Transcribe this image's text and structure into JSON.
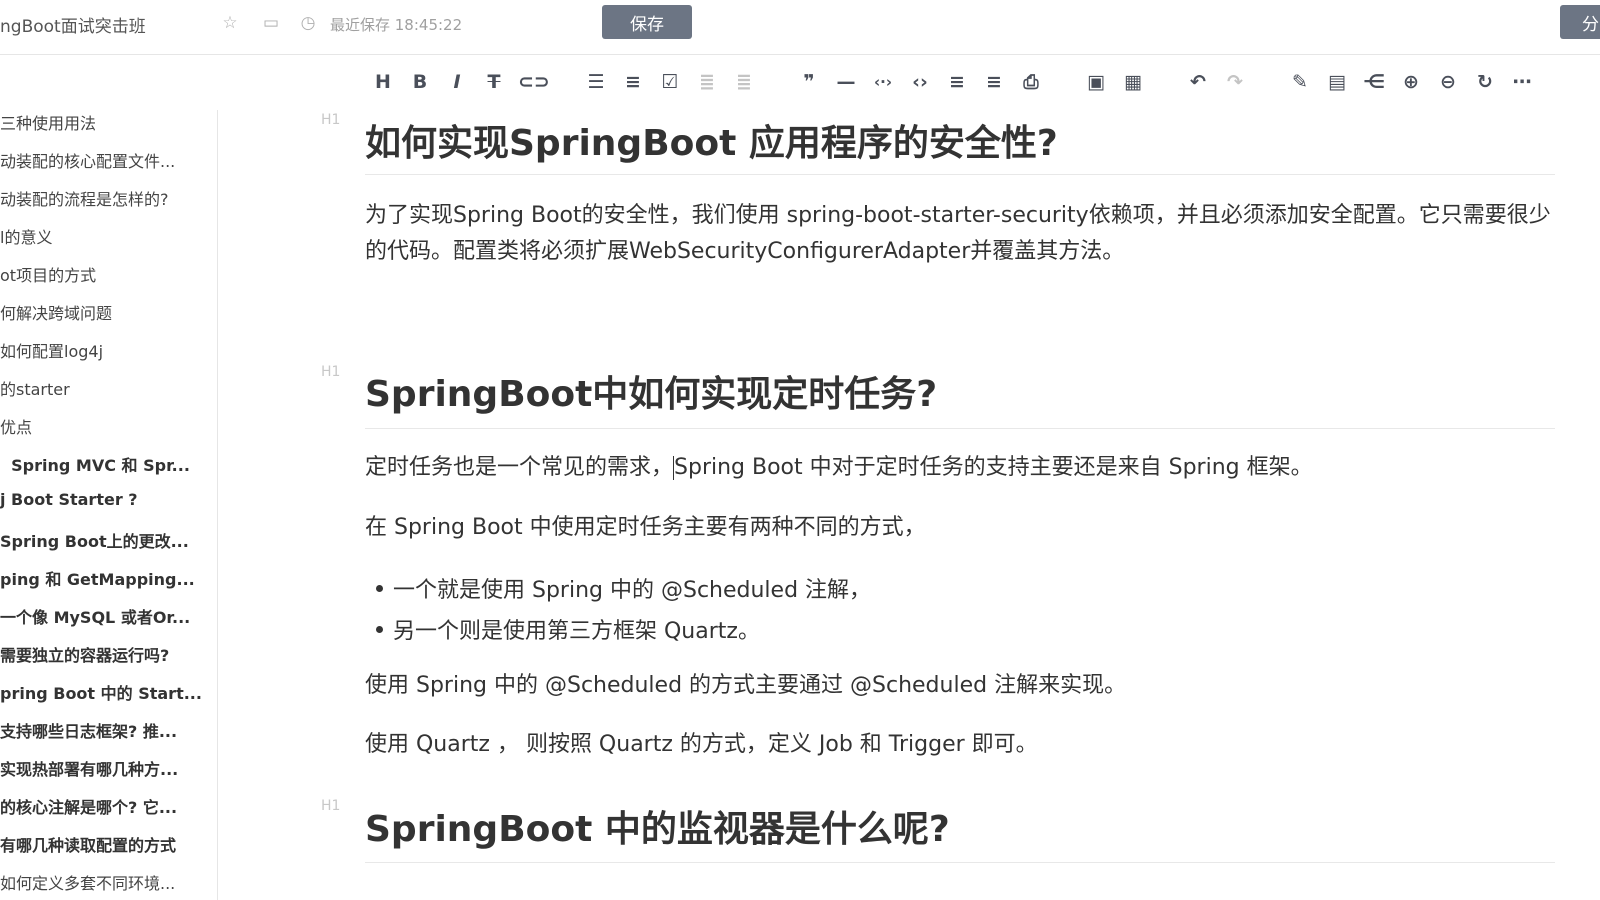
{
  "header": {
    "doc_title": "ngBoot面试突击班",
    "save_status": "最近保存 18:45:22",
    "save_label": "保存",
    "share_label": "分"
  },
  "toolbar": {
    "icons": [
      "heading-icon",
      "bold-icon",
      "italic-icon",
      "strikethrough-icon",
      "link-icon",
      "bullet-list-icon",
      "numbered-list-icon",
      "task-list-icon",
      "indent-icon",
      "outdent-icon",
      "quote-icon",
      "horizontal-rule-icon",
      "inline-code-icon",
      "code-block-icon",
      "insert-before-icon",
      "insert-after-icon",
      "print-icon",
      "image-icon",
      "table-icon",
      "undo-icon",
      "redo-icon",
      "edit-icon",
      "outline-icon",
      "mindmap-icon",
      "zoom-in-icon",
      "zoom-out-icon",
      "refresh-icon",
      "more-icon"
    ]
  },
  "sidebar": {
    "items": [
      {
        "label": "三种使用用法",
        "bold": false
      },
      {
        "label": "动装配的核心配置文件...",
        "bold": false
      },
      {
        "label": "动装配的流程是怎样的?",
        "bold": false
      },
      {
        "label": "l的意义",
        "bold": false
      },
      {
        "label": "ot项目的方式",
        "bold": false
      },
      {
        "label": "何解决跨域问题",
        "bold": false
      },
      {
        "label": "如何配置log4j",
        "bold": false
      },
      {
        "label": "的starter",
        "bold": false
      },
      {
        "label": "优点",
        "bold": false
      },
      {
        "label": "  Spring MVC 和 Spr...",
        "bold": true
      },
      {
        "label": "j Boot Starter ?",
        "bold": true
      },
      {
        "label": "Spring Boot上的更改...",
        "bold": true
      },
      {
        "label": "ping 和 GetMapping...",
        "bold": true
      },
      {
        "label": "一个像 MySQL 或者Or...",
        "bold": true
      },
      {
        "label": "需要独立的容器运行吗?",
        "bold": true
      },
      {
        "label": "pring Boot 中的 Start...",
        "bold": true
      },
      {
        "label": "支持哪些日志框架? 推...",
        "bold": true
      },
      {
        "label": "实现热部署有哪几种方...",
        "bold": true
      },
      {
        "label": "的核心注解是哪个? 它...",
        "bold": true
      },
      {
        "label": "有哪几种读取配置的方式",
        "bold": true
      },
      {
        "label": "如何定义多套不同环境...",
        "bold": false
      }
    ]
  },
  "content": {
    "h1_marker": "H1",
    "sections": [
      {
        "heading": "如何实现SpringBoot 应用程序的安全性?",
        "para1": "为了实现Spring Boot的安全性，我们使用 spring-boot-starter-security依赖项，并且必须添加安全配置。它只需要很少的代码。配置类将必须扩展WebSecurityConfigurerAdapter并覆盖其方法。"
      },
      {
        "heading": "SpringBoot中如何实现定时任务?",
        "para1_a": "定时任务也是一个常见的需求，",
        "para1_b": "Spring Boot 中对于定时任务的支持主要还是来自 Spring 框架。",
        "para2": "在 Spring Boot 中使用定时任务主要有两种不同的方式，",
        "bullets": [
          "一个就是使用 Spring 中的 @Scheduled 注解，",
          "另一个则是使用第三方框架 Quartz。"
        ],
        "para3": "使用 Spring 中的 @Scheduled 的方式主要通过 @Scheduled 注解来实现。",
        "para4": "使用 Quartz ， 则按照 Quartz 的方式，定义 Job 和 Trigger 即可。"
      },
      {
        "heading": "SpringBoot 中的监视器是什么呢?"
      }
    ]
  }
}
